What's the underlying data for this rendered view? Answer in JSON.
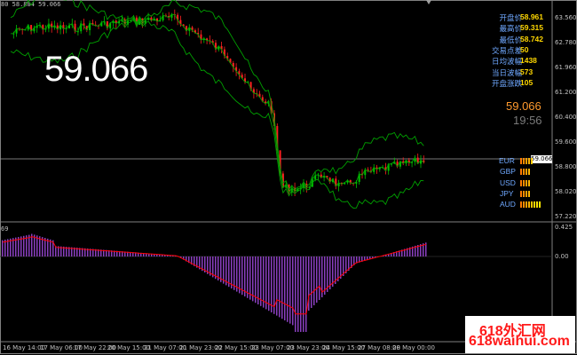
{
  "header": {
    "text": "80 58.884 59.066"
  },
  "big_price": "59.066",
  "indicator_header": "69",
  "price_axis": [
    "63.560",
    "62.780",
    "61.960",
    "61.200",
    "60.400",
    "59.600",
    "58.800",
    "58.020",
    "57.220"
  ],
  "indicator_axis": [
    "0.425",
    "0.00",
    "-0.569"
  ],
  "current_price_tag": "59.066",
  "time_axis": [
    "16 May 14:00",
    "17 May 06:00",
    "17 May 22:00",
    "20 May 15:00",
    "21 May 07:00",
    "21 May 23:00",
    "22 May 15:00",
    "23 May 07:00",
    "23 May 23:00",
    "24 May 15:00",
    "27 May 08:00",
    "28 May 00:00"
  ],
  "info_panel": {
    "rows": [
      {
        "label": "开盘价",
        "value": "58.961"
      },
      {
        "label": "最高价",
        "value": "59.315"
      },
      {
        "label": "最低价",
        "value": "58.742"
      },
      {
        "label": "交易点差",
        "value": "50"
      },
      {
        "label": "日均波幅",
        "value": "1438"
      },
      {
        "label": "当日波幅",
        "value": "573"
      },
      {
        "label": "开盘涨跌",
        "value": "105"
      }
    ],
    "current": "59.066",
    "clock": "19:56"
  },
  "currency_strength": [
    {
      "name": "EUR",
      "bars": 5
    },
    {
      "name": "GBP",
      "bars": 4
    },
    {
      "name": "USD",
      "bars": 4
    },
    {
      "name": "JPY",
      "bars": 4
    },
    {
      "name": "AUD",
      "bars": 8
    }
  ],
  "watermark": {
    "line1": "618外汇网",
    "line2": "618waihui.com"
  },
  "colors": {
    "bull": "#00c000",
    "bear": "#ff2020",
    "bands": "#00a000",
    "signal": "#ff0000",
    "histogram": "#8a3fbf",
    "info_label": "#6fa8ff",
    "info_value": "#ffd700"
  }
}
